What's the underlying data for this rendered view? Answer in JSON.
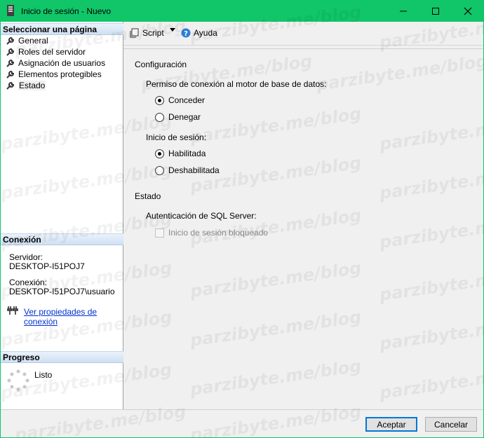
{
  "window": {
    "title": "Inicio de sesión - Nuevo"
  },
  "left_panel": {
    "select_page_header": "Seleccionar una página",
    "pages": [
      {
        "label": "General"
      },
      {
        "label": "Roles del servidor"
      },
      {
        "label": "Asignación de usuarios"
      },
      {
        "label": "Elementos protegibles"
      },
      {
        "label": "Estado"
      }
    ],
    "connection_header": "Conexión",
    "server_label": "Servidor:",
    "server_value": "DESKTOP-I51POJ7",
    "connection_label": "Conexión:",
    "connection_value": "DESKTOP-I51POJ7\\usuario",
    "connection_props_link": "Ver propiedades de conexión",
    "progress_header": "Progreso",
    "progress_status": "Listo"
  },
  "toolbar": {
    "script_label": "Script",
    "help_label": "Ayuda"
  },
  "content": {
    "config_title": "Configuración",
    "permission_label": "Permiso de conexión al motor de base de datos:",
    "grant_label": "Conceder",
    "deny_label": "Denegar",
    "login_label": "Inicio de sesión:",
    "enabled_label": "Habilitada",
    "disabled_label": "Deshabilitada",
    "status_title": "Estado",
    "sql_auth_label": "Autenticación de SQL Server:",
    "locked_label": "Inicio de sesión bloqueado"
  },
  "footer": {
    "ok_label": "Aceptar",
    "cancel_label": "Cancelar"
  },
  "watermark": "parzibyte.me/blog"
}
